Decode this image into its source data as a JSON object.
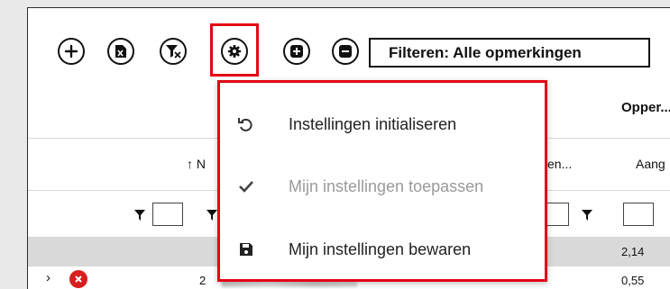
{
  "toolbar": {
    "buttons": [
      {
        "icon": "add-icon"
      },
      {
        "icon": "export-excel-icon"
      },
      {
        "icon": "clear-filter-icon"
      },
      {
        "icon": "settings-gear-icon"
      },
      {
        "icon": "expand-all-icon"
      },
      {
        "icon": "collapse-all-icon"
      }
    ],
    "filter_label": "Filteren: Alle opmerkingen"
  },
  "grid": {
    "header1_right": "Opper...",
    "header2_sort": "↑ N",
    "header2_mid": "en...",
    "header2_right": "Aang",
    "group_row_value": "2,14",
    "data_row_value": "0,55",
    "data_row_number": "2"
  },
  "settings_menu": {
    "items": [
      {
        "label": "Instellingen initialiseren",
        "icon": "reset-icon",
        "disabled": false
      },
      {
        "label": "Mijn instellingen toepassen",
        "icon": "checkmark-icon",
        "disabled": true
      },
      {
        "label": "Mijn instellingen bewaren",
        "icon": "save-icon",
        "disabled": false
      }
    ]
  },
  "colors": {
    "highlight": "#e30613",
    "error": "#d81e1e"
  }
}
